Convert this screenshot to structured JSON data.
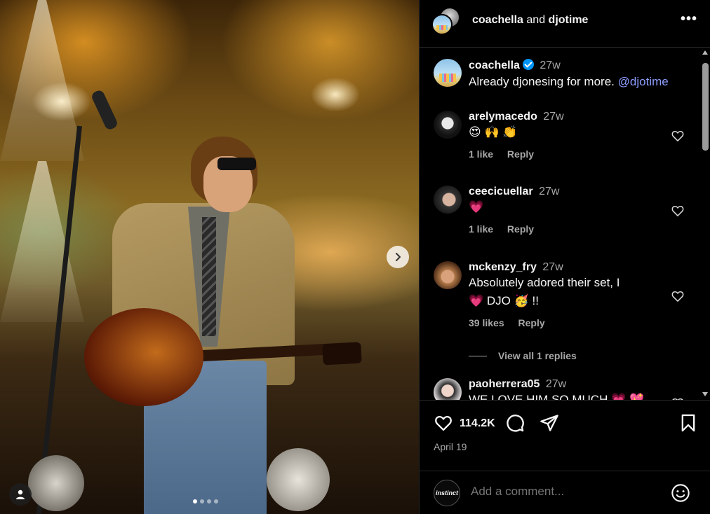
{
  "header": {
    "owner": "coachella",
    "and": "and",
    "collaborator": "djotime",
    "more_icon": "more-horizontal-icon"
  },
  "caption": {
    "username": "coachella",
    "verified": true,
    "time": "27w",
    "text": "Already djonesing for more.",
    "mention": "@djotime"
  },
  "comments": [
    {
      "username": "arelymacedo",
      "time": "27w",
      "text": "😍 🙌 👏",
      "likes": "1 like",
      "reply": "Reply"
    },
    {
      "username": "ceecicuellar",
      "time": "27w",
      "text": "💗",
      "likes": "1 like",
      "reply": "Reply"
    },
    {
      "username": "mckenzy_fry",
      "time": "27w",
      "text_line1": "Absolutely adored their set, I",
      "text_line2": "💗 DJO 🥳 !!",
      "likes": "39 likes",
      "reply": "Reply",
      "view_replies": "View all 1 replies"
    },
    {
      "username": "paoherrera05",
      "time": "27w",
      "text": "WE LOVE HIM SO MUCH 💗 💖"
    }
  ],
  "actions": {
    "likes_count": "114.2K",
    "date": "April 19"
  },
  "composer": {
    "avatar_text": "instinct",
    "placeholder": "Add a comment..."
  },
  "colors": {
    "background": "#000000",
    "text": "#f5f5f5",
    "muted": "#a8a8a8",
    "mention": "#8d9dff",
    "verified": "#0095f6",
    "divider": "#262626"
  }
}
